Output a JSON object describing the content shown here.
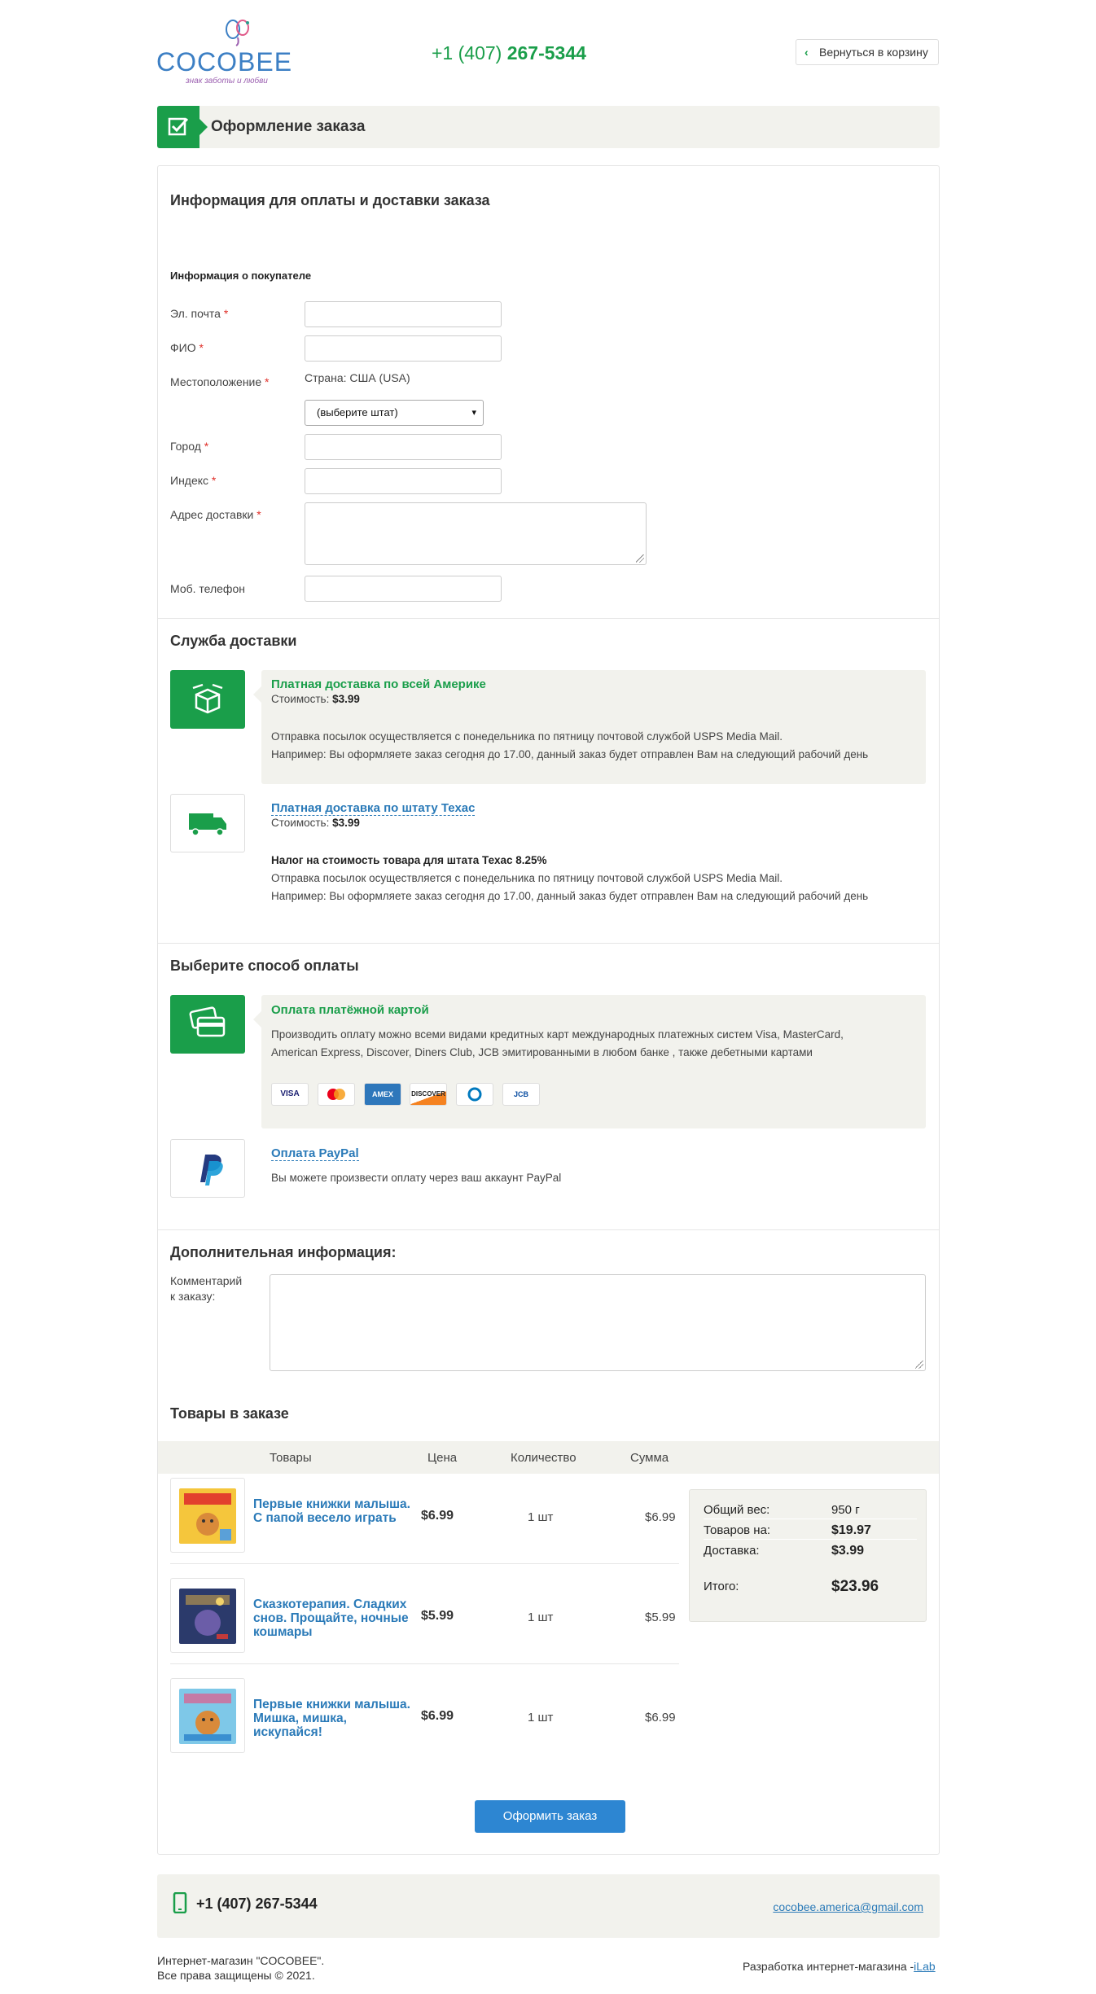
{
  "header": {
    "logo_text": "COCOBEE",
    "logo_tagline": "знак заботы и любви",
    "phone_prefix": "+1 (407)",
    "phone_number": "267-5344",
    "back_label": "Вернуться в корзину"
  },
  "title": "Оформление заказа",
  "billing": {
    "section_title": "Информация для оплаты и доставки заказа",
    "buyer_title": "Информация о покупателе",
    "fields": {
      "email": "Эл. почта",
      "name": "ФИО",
      "location": "Местоположение",
      "city": "Город",
      "zip": "Индекс",
      "address": "Адрес доставки",
      "phone": "Моб. телефон"
    },
    "required_mark": "*",
    "country_text": "Страна: США (USA)",
    "state_select": "(выберите штат)"
  },
  "delivery": {
    "section_title": "Служба доставки",
    "options": [
      {
        "name": "Платная доставка по всей Америке",
        "cost_label": "Стоимость:",
        "cost": "$3.99",
        "tax": "",
        "line1": "Отправка посылок осуществляется с понедельника по пятницу почтовой службой USPS Media Mail.",
        "line2": "Например: Вы оформляете заказ сегодня до 17.00, данный заказ будет отправлен Вам на следующий рабочий день"
      },
      {
        "name": "Платная доставка по штату Техас",
        "cost_label": "Стоимость:",
        "cost": "$3.99",
        "tax": "Налог на стоимость товара для штата Техас 8.25%",
        "line1": "Отправка посылок осуществляется с понедельника по пятницу почтовой службой USPS Media Mail.",
        "line2": "Например: Вы оформляете заказ сегодня до 17.00, данный заказ будет отправлен Вам на следующий рабочий день"
      }
    ]
  },
  "payment": {
    "section_title": "Выберите способ оплаты",
    "card_name": "Оплата платёжной картой",
    "card_desc1": "Производить оплату можно всеми видами кредитных карт международных платежных систем Visa, MasterCard,",
    "card_desc2": "American Express, Discover, Diners Club, JCB эмитированными в любом банке , также дебетными картами",
    "cards": [
      "VISA",
      "",
      "AMEX",
      "DISCOVER",
      "",
      "JCB"
    ],
    "paypal_name": "Оплата PayPal",
    "paypal_desc": "Вы можете произвести оплату через ваш аккаунт PayPal"
  },
  "extra": {
    "section_title": "Дополнительная информация:",
    "comment_label_1": "Комментарий",
    "comment_label_2": "к заказу:"
  },
  "order": {
    "section_title": "Товары в заказе",
    "columns": {
      "goods": "Товары",
      "price": "Цена",
      "qty": "Количество",
      "sum": "Сумма"
    },
    "items": [
      {
        "name": "Первые книжки малыша. С папой весело играть",
        "price": "$6.99",
        "qty": "1 шт",
        "sum": "$6.99"
      },
      {
        "name": "Сказкотерапия. Сладких снов. Прощайте, ночные кошмары",
        "price": "$5.99",
        "qty": "1 шт",
        "sum": "$5.99"
      },
      {
        "name": "Первые книжки малыша. Мишка, мишка, искупайся!",
        "price": "$6.99",
        "qty": "1 шт",
        "sum": "$6.99"
      }
    ],
    "summary": {
      "weight_label": "Общий вес:",
      "weight": "950 г",
      "goods_label": "Товаров на:",
      "goods": "$19.97",
      "delivery_label": "Доставка:",
      "delivery": "$3.99",
      "total_label": "Итого:",
      "total": "$23.96"
    },
    "submit_label": "Оформить заказ"
  },
  "footer": {
    "phone": "+1 (407)  267-5344",
    "email": "cocobee.america@gmail.com",
    "copy_1": "Интернет-магазин \"COCOBEE\".",
    "copy_2": "Все права защищены © 2021.",
    "dev_text": "Разработка интернет-магазина -",
    "dev_link": "iLab"
  },
  "colors": {
    "green": "#1a9e4a",
    "blue": "#2d86d2",
    "link": "#2a7ab8",
    "panel": "#f2f2ed"
  }
}
